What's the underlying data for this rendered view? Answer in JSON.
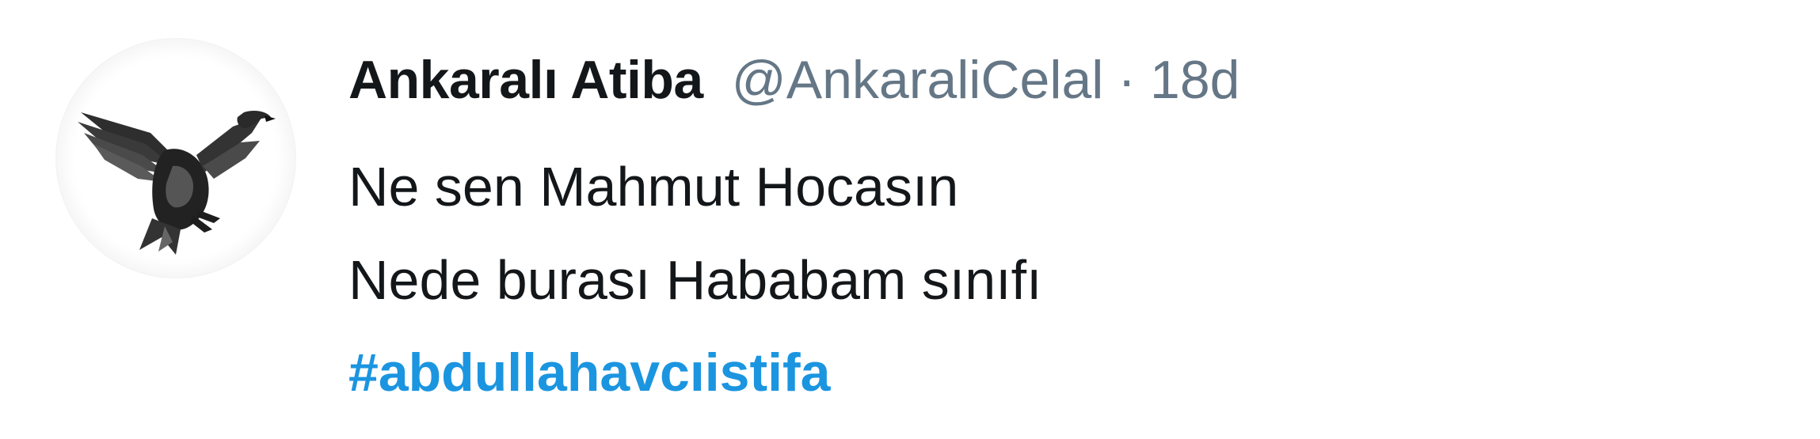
{
  "tweet": {
    "display_name": "Ankaralı Atiba",
    "handle": "@AnkaraliCelal",
    "separator": "·",
    "timestamp": "18d",
    "text_lines": [
      "Ne sen Mahmut Hocasın",
      "Nede burası Hababam sınıfı"
    ],
    "hashtag": "#abdullahavcıistifa",
    "avatar_icon": "eagle-icon"
  },
  "colors": {
    "name": "#14171a",
    "meta": "#657786",
    "hashtag": "#1b95e0",
    "background": "#ffffff"
  }
}
